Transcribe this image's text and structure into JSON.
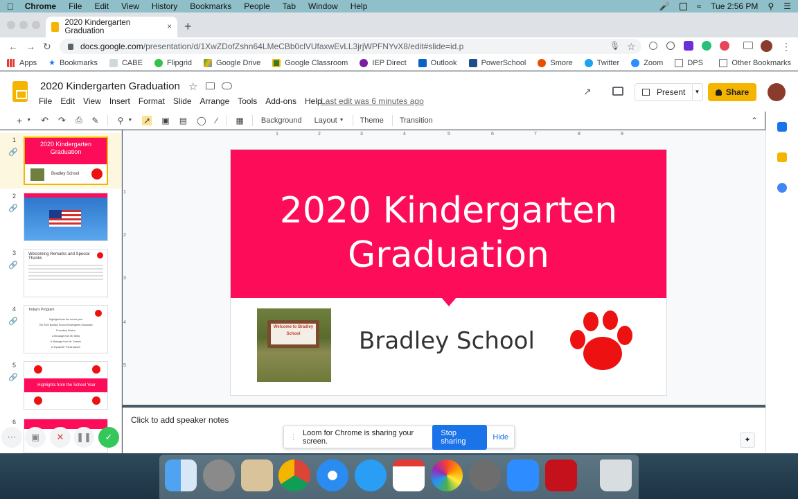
{
  "menubar": {
    "app": "Chrome",
    "items": [
      "File",
      "Edit",
      "View",
      "History",
      "Bookmarks",
      "People",
      "Tab",
      "Window",
      "Help"
    ],
    "clock": "Tue 2:56 PM"
  },
  "tab": {
    "title": "2020 Kindergarten Graduation",
    "close": "×",
    "new_tab": "+"
  },
  "address": {
    "domain": "docs.google.com",
    "path": "/presentation/d/1XwZDofZshn64LMeCBb0clVUfaxwEvLL3jrjWPFNYvX8/edit#slide=id.p"
  },
  "bookmarks": {
    "items": [
      "Apps",
      "Bookmarks",
      "CABE",
      "Flipgrid",
      "Google Drive",
      "Google Classroom",
      "IEP Direct",
      "Outlook",
      "PowerSchool",
      "Smore",
      "Twitter",
      "Zoom",
      "DPS"
    ],
    "other": "Other Bookmarks"
  },
  "doc": {
    "title": "2020 Kindergarten Graduation",
    "menus": [
      "File",
      "Edit",
      "View",
      "Insert",
      "Format",
      "Slide",
      "Arrange",
      "Tools",
      "Add-ons",
      "Help"
    ],
    "last_edit": "Last edit was 6 minutes ago",
    "present_label": "Present",
    "share_label": "Share"
  },
  "toolbar": {
    "background": "Background",
    "layout": "Layout",
    "theme": "Theme",
    "transition": "Transition"
  },
  "ruler": {
    "top": [
      "1",
      "2",
      "3",
      "4",
      "5",
      "6",
      "7",
      "8",
      "9"
    ],
    "left": [
      "1",
      "2",
      "3",
      "4",
      "5"
    ]
  },
  "filmstrip": {
    "numbers": [
      "1",
      "2",
      "3",
      "4",
      "5",
      "6"
    ],
    "slide1_title": "2020 Kindergarten Graduation",
    "slide1_sub": "Bradley School",
    "slide3_title": "Welcoming Remarks and Special Thanks",
    "slide4_title": "Today's Program",
    "slide4_lines": [
      "Highlights from the school year",
      "The 2020 Bradley School Kindergarten Graduates",
      "Promotion Entries",
      "A Message from Mr. Bella",
      "A Message from Mr. Cesario",
      "A \"Dynamite\" Performance!"
    ],
    "slide5_title": "Highlights from the School Year"
  },
  "slide": {
    "title_line1": "2020 Kindergarten",
    "title_line2": "Graduation",
    "school": "Bradley School",
    "sign_text": "Welcome to Bradley School"
  },
  "notes": {
    "placeholder": "Click to add speaker notes"
  },
  "loom": {
    "message": "Loom for Chrome is sharing your screen.",
    "stop": "Stop sharing",
    "hide": "Hide"
  },
  "colors": {
    "banner": "#fc0c59",
    "share": "#f4b400",
    "paw": "#ee1111",
    "link": "#1a73e8"
  }
}
